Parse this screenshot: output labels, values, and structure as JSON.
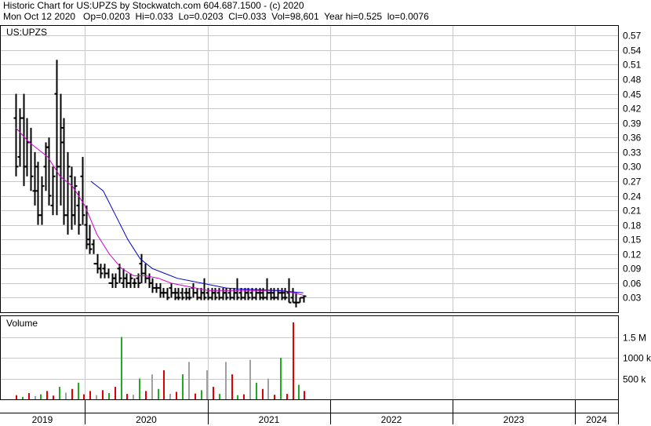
{
  "header": {
    "line1": "Historic Chart for US:UPZS by Stockwatch.com 604.687.1500 - (c) 2020",
    "line2": "Mon Oct 12 2020   Op=0.0203  Hi=0.033  Lo=0.0203  Cl=0.033  Vol=98,601  Year hi=0.525  lo=0.0076"
  },
  "chart_data": [
    {
      "type": "candlestick",
      "title": "US:UPZS",
      "ylim": [
        0,
        0.59
      ],
      "y_ticks": [
        "0.57",
        "0.54",
        "0.51",
        "0.48",
        "0.45",
        "0.42",
        "0.39",
        "0.36",
        "0.33",
        "0.30",
        "0.27",
        "0.24",
        "0.21",
        "0.18",
        "0.15",
        "0.12",
        "0.09",
        "0.06",
        "0.03"
      ],
      "x_ticks": [
        "2019",
        "2020",
        "2021",
        "2022",
        "2023",
        "2024"
      ],
      "grid": true,
      "series": [
        {
          "style": "price-bars",
          "x": [
            2018.44,
            2018.47,
            2018.5,
            2018.53,
            2018.56,
            2018.59,
            2018.62,
            2018.65,
            2018.68,
            2018.71,
            2018.74,
            2018.77,
            2018.8,
            2018.83,
            2018.86,
            2018.89,
            2018.92,
            2018.95,
            2018.98,
            2019.01,
            2019.04,
            2019.07,
            2019.1,
            2019.13,
            2019.16,
            2019.19,
            2019.22,
            2019.25,
            2019.28,
            2019.31,
            2019.34,
            2019.37,
            2019.4,
            2019.43,
            2019.46,
            2019.49,
            2019.52,
            2019.55,
            2019.58,
            2019.61,
            2019.64,
            2019.67,
            2019.7,
            2019.73,
            2019.76,
            2019.79,
            2019.82,
            2019.85,
            2019.88,
            2019.91,
            2019.94,
            2019.97,
            2020.0,
            2020.03,
            2020.06,
            2020.09,
            2020.12,
            2020.15,
            2020.18,
            2020.21,
            2020.24,
            2020.27,
            2020.3,
            2020.33,
            2020.36,
            2020.39,
            2020.42,
            2020.45,
            2020.48,
            2020.51,
            2020.54,
            2020.57,
            2020.6,
            2020.63,
            2020.66,
            2020.69,
            2020.72,
            2020.75,
            2020.78
          ],
          "high": [
            0.45,
            0.42,
            0.45,
            0.4,
            0.38,
            0.33,
            0.31,
            0.28,
            0.35,
            0.36,
            0.3,
            0.52,
            0.45,
            0.4,
            0.33,
            0.3,
            0.28,
            0.25,
            0.32,
            0.22,
            0.18,
            0.15,
            0.12,
            0.1,
            0.1,
            0.09,
            0.08,
            0.08,
            0.1,
            0.09,
            0.08,
            0.08,
            0.07,
            0.08,
            0.12,
            0.1,
            0.08,
            0.07,
            0.06,
            0.06,
            0.05,
            0.05,
            0.06,
            0.05,
            0.05,
            0.05,
            0.05,
            0.05,
            0.06,
            0.05,
            0.05,
            0.07,
            0.05,
            0.05,
            0.05,
            0.05,
            0.05,
            0.05,
            0.05,
            0.05,
            0.07,
            0.05,
            0.05,
            0.05,
            0.05,
            0.05,
            0.05,
            0.05,
            0.07,
            0.05,
            0.05,
            0.05,
            0.05,
            0.05,
            0.07,
            0.05,
            0.04,
            0.03,
            0.035
          ],
          "low": [
            0.28,
            0.3,
            0.26,
            0.28,
            0.25,
            0.22,
            0.18,
            0.18,
            0.25,
            0.22,
            0.2,
            0.2,
            0.22,
            0.18,
            0.16,
            0.17,
            0.18,
            0.16,
            0.18,
            0.13,
            0.12,
            0.12,
            0.08,
            0.07,
            0.07,
            0.07,
            0.05,
            0.05,
            0.06,
            0.05,
            0.05,
            0.05,
            0.05,
            0.05,
            0.06,
            0.06,
            0.05,
            0.04,
            0.04,
            0.03,
            0.03,
            0.025,
            0.03,
            0.025,
            0.025,
            0.025,
            0.025,
            0.025,
            0.03,
            0.025,
            0.025,
            0.025,
            0.025,
            0.025,
            0.025,
            0.025,
            0.025,
            0.025,
            0.025,
            0.025,
            0.025,
            0.025,
            0.025,
            0.025,
            0.025,
            0.025,
            0.025,
            0.025,
            0.025,
            0.025,
            0.025,
            0.025,
            0.025,
            0.025,
            0.02,
            0.02,
            0.01,
            0.02,
            0.02
          ],
          "open": [
            0.4,
            0.32,
            0.4,
            0.3,
            0.35,
            0.25,
            0.25,
            0.2,
            0.3,
            0.34,
            0.22,
            0.45,
            0.3,
            0.35,
            0.2,
            0.28,
            0.2,
            0.22,
            0.28,
            0.18,
            0.15,
            0.14,
            0.1,
            0.09,
            0.09,
            0.08,
            0.06,
            0.07,
            0.09,
            0.06,
            0.07,
            0.06,
            0.06,
            0.07,
            0.1,
            0.08,
            0.07,
            0.06,
            0.05,
            0.05,
            0.04,
            0.04,
            0.05,
            0.04,
            0.04,
            0.04,
            0.04,
            0.04,
            0.05,
            0.04,
            0.03,
            0.04,
            0.04,
            0.03,
            0.04,
            0.04,
            0.03,
            0.04,
            0.04,
            0.03,
            0.04,
            0.04,
            0.03,
            0.04,
            0.04,
            0.03,
            0.04,
            0.04,
            0.03,
            0.04,
            0.04,
            0.03,
            0.04,
            0.04,
            0.04,
            0.03,
            0.02,
            0.02,
            0.03
          ],
          "close": [
            0.3,
            0.4,
            0.3,
            0.35,
            0.28,
            0.3,
            0.2,
            0.26,
            0.34,
            0.24,
            0.28,
            0.3,
            0.38,
            0.2,
            0.3,
            0.2,
            0.26,
            0.18,
            0.2,
            0.14,
            0.13,
            0.1,
            0.09,
            0.08,
            0.08,
            0.06,
            0.07,
            0.06,
            0.07,
            0.07,
            0.06,
            0.07,
            0.06,
            0.06,
            0.08,
            0.07,
            0.06,
            0.05,
            0.05,
            0.04,
            0.04,
            0.03,
            0.04,
            0.03,
            0.03,
            0.03,
            0.03,
            0.03,
            0.04,
            0.03,
            0.04,
            0.03,
            0.03,
            0.04,
            0.03,
            0.03,
            0.04,
            0.03,
            0.03,
            0.04,
            0.03,
            0.03,
            0.04,
            0.03,
            0.03,
            0.04,
            0.03,
            0.03,
            0.04,
            0.03,
            0.03,
            0.04,
            0.03,
            0.03,
            0.02,
            0.02,
            0.02,
            0.03,
            0.033
          ]
        },
        {
          "style": "moving-average-short",
          "color": "#d400d4",
          "x": [
            2018.44,
            2018.55,
            2018.7,
            2018.8,
            2018.9,
            2019.0,
            2019.1,
            2019.2,
            2019.3,
            2019.4,
            2019.5,
            2019.6,
            2019.7,
            2019.8,
            2019.9,
            2020.0,
            2020.1,
            2020.2,
            2020.3,
            2020.4,
            2020.5,
            2020.6,
            2020.7,
            2020.78
          ],
          "y": [
            0.38,
            0.35,
            0.32,
            0.28,
            0.26,
            0.22,
            0.16,
            0.12,
            0.09,
            0.075,
            0.075,
            0.07,
            0.06,
            0.055,
            0.05,
            0.045,
            0.045,
            0.045,
            0.045,
            0.045,
            0.045,
            0.045,
            0.04,
            0.035
          ]
        },
        {
          "style": "moving-average-long",
          "color": "#0000cc",
          "x": [
            2019.05,
            2019.15,
            2019.25,
            2019.35,
            2019.45,
            2019.55,
            2019.65,
            2019.75,
            2019.85,
            2019.95,
            2020.05,
            2020.15,
            2020.25,
            2020.35,
            2020.45,
            2020.55,
            2020.65,
            2020.78
          ],
          "y": [
            0.27,
            0.25,
            0.2,
            0.15,
            0.11,
            0.09,
            0.08,
            0.07,
            0.065,
            0.06,
            0.055,
            0.05,
            0.048,
            0.047,
            0.046,
            0.045,
            0.043,
            0.04
          ]
        }
      ]
    },
    {
      "type": "bar",
      "title": "Volume",
      "ylim": [
        0,
        2000000
      ],
      "y_ticks": [
        "1.5 M",
        "1000 k",
        "500 k"
      ],
      "y_tick_values": [
        1500000,
        1000000,
        500000
      ],
      "x": [
        2018.44,
        2018.49,
        2018.54,
        2018.59,
        2018.64,
        2018.69,
        2018.74,
        2018.79,
        2018.84,
        2018.89,
        2018.94,
        2018.99,
        2019.04,
        2019.09,
        2019.14,
        2019.19,
        2019.24,
        2019.29,
        2019.34,
        2019.39,
        2019.44,
        2019.49,
        2019.54,
        2019.59,
        2019.64,
        2019.69,
        2019.74,
        2019.79,
        2019.84,
        2019.89,
        2019.94,
        2019.99,
        2020.04,
        2020.09,
        2020.14,
        2020.19,
        2020.24,
        2020.29,
        2020.34,
        2020.39,
        2020.44,
        2020.49,
        2020.54,
        2020.59,
        2020.64,
        2020.69,
        2020.74,
        2020.78
      ],
      "values": [
        100000,
        60000,
        150000,
        80000,
        120000,
        200000,
        90000,
        300000,
        160000,
        250000,
        400000,
        120000,
        200000,
        100000,
        220000,
        150000,
        300000,
        1500000,
        130000,
        110000,
        500000,
        200000,
        600000,
        250000,
        700000,
        130000,
        180000,
        600000,
        900000,
        140000,
        220000,
        700000,
        300000,
        130000,
        900000,
        600000,
        100000,
        120000,
        950000,
        400000,
        250000,
        500000,
        110000,
        1000000,
        130000,
        1850000,
        350000,
        200000
      ],
      "colors": [
        "red",
        "green",
        "red",
        "grey",
        "green",
        "red",
        "red",
        "green",
        "grey",
        "red",
        "green",
        "red",
        "red",
        "grey",
        "red",
        "green",
        "red",
        "green",
        "red",
        "grey",
        "green",
        "red",
        "grey",
        "green",
        "red",
        "grey",
        "red",
        "green",
        "grey",
        "red",
        "green",
        "grey",
        "red",
        "green",
        "grey",
        "red",
        "green",
        "red",
        "grey",
        "green",
        "red",
        "grey",
        "red",
        "green",
        "red",
        "red",
        "green",
        "red"
      ]
    }
  ],
  "colors": {
    "red": "#e00000",
    "green": "#22aa22",
    "grey": "#a0a0a0",
    "grid": "#c8c8c8",
    "bar": "#000000"
  }
}
